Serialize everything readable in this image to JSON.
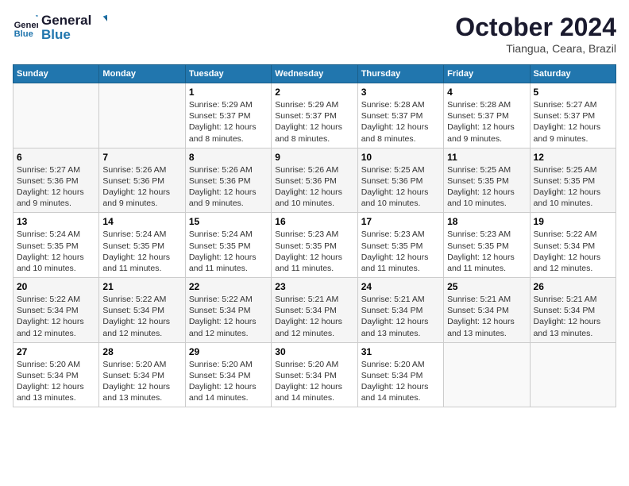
{
  "logo": {
    "line1": "General",
    "line2": "Blue"
  },
  "title": "October 2024",
  "location": "Tiangua, Ceara, Brazil",
  "days_of_week": [
    "Sunday",
    "Monday",
    "Tuesday",
    "Wednesday",
    "Thursday",
    "Friday",
    "Saturday"
  ],
  "weeks": [
    [
      {
        "day": "",
        "info": ""
      },
      {
        "day": "",
        "info": ""
      },
      {
        "day": "1",
        "info": "Sunrise: 5:29 AM\nSunset: 5:37 PM\nDaylight: 12 hours and 8 minutes."
      },
      {
        "day": "2",
        "info": "Sunrise: 5:29 AM\nSunset: 5:37 PM\nDaylight: 12 hours and 8 minutes."
      },
      {
        "day": "3",
        "info": "Sunrise: 5:28 AM\nSunset: 5:37 PM\nDaylight: 12 hours and 8 minutes."
      },
      {
        "day": "4",
        "info": "Sunrise: 5:28 AM\nSunset: 5:37 PM\nDaylight: 12 hours and 9 minutes."
      },
      {
        "day": "5",
        "info": "Sunrise: 5:27 AM\nSunset: 5:37 PM\nDaylight: 12 hours and 9 minutes."
      }
    ],
    [
      {
        "day": "6",
        "info": "Sunrise: 5:27 AM\nSunset: 5:36 PM\nDaylight: 12 hours and 9 minutes."
      },
      {
        "day": "7",
        "info": "Sunrise: 5:26 AM\nSunset: 5:36 PM\nDaylight: 12 hours and 9 minutes."
      },
      {
        "day": "8",
        "info": "Sunrise: 5:26 AM\nSunset: 5:36 PM\nDaylight: 12 hours and 9 minutes."
      },
      {
        "day": "9",
        "info": "Sunrise: 5:26 AM\nSunset: 5:36 PM\nDaylight: 12 hours and 10 minutes."
      },
      {
        "day": "10",
        "info": "Sunrise: 5:25 AM\nSunset: 5:36 PM\nDaylight: 12 hours and 10 minutes."
      },
      {
        "day": "11",
        "info": "Sunrise: 5:25 AM\nSunset: 5:35 PM\nDaylight: 12 hours and 10 minutes."
      },
      {
        "day": "12",
        "info": "Sunrise: 5:25 AM\nSunset: 5:35 PM\nDaylight: 12 hours and 10 minutes."
      }
    ],
    [
      {
        "day": "13",
        "info": "Sunrise: 5:24 AM\nSunset: 5:35 PM\nDaylight: 12 hours and 10 minutes."
      },
      {
        "day": "14",
        "info": "Sunrise: 5:24 AM\nSunset: 5:35 PM\nDaylight: 12 hours and 11 minutes."
      },
      {
        "day": "15",
        "info": "Sunrise: 5:24 AM\nSunset: 5:35 PM\nDaylight: 12 hours and 11 minutes."
      },
      {
        "day": "16",
        "info": "Sunrise: 5:23 AM\nSunset: 5:35 PM\nDaylight: 12 hours and 11 minutes."
      },
      {
        "day": "17",
        "info": "Sunrise: 5:23 AM\nSunset: 5:35 PM\nDaylight: 12 hours and 11 minutes."
      },
      {
        "day": "18",
        "info": "Sunrise: 5:23 AM\nSunset: 5:35 PM\nDaylight: 12 hours and 11 minutes."
      },
      {
        "day": "19",
        "info": "Sunrise: 5:22 AM\nSunset: 5:34 PM\nDaylight: 12 hours and 12 minutes."
      }
    ],
    [
      {
        "day": "20",
        "info": "Sunrise: 5:22 AM\nSunset: 5:34 PM\nDaylight: 12 hours and 12 minutes."
      },
      {
        "day": "21",
        "info": "Sunrise: 5:22 AM\nSunset: 5:34 PM\nDaylight: 12 hours and 12 minutes."
      },
      {
        "day": "22",
        "info": "Sunrise: 5:22 AM\nSunset: 5:34 PM\nDaylight: 12 hours and 12 minutes."
      },
      {
        "day": "23",
        "info": "Sunrise: 5:21 AM\nSunset: 5:34 PM\nDaylight: 12 hours and 12 minutes."
      },
      {
        "day": "24",
        "info": "Sunrise: 5:21 AM\nSunset: 5:34 PM\nDaylight: 12 hours and 13 minutes."
      },
      {
        "day": "25",
        "info": "Sunrise: 5:21 AM\nSunset: 5:34 PM\nDaylight: 12 hours and 13 minutes."
      },
      {
        "day": "26",
        "info": "Sunrise: 5:21 AM\nSunset: 5:34 PM\nDaylight: 12 hours and 13 minutes."
      }
    ],
    [
      {
        "day": "27",
        "info": "Sunrise: 5:20 AM\nSunset: 5:34 PM\nDaylight: 12 hours and 13 minutes."
      },
      {
        "day": "28",
        "info": "Sunrise: 5:20 AM\nSunset: 5:34 PM\nDaylight: 12 hours and 13 minutes."
      },
      {
        "day": "29",
        "info": "Sunrise: 5:20 AM\nSunset: 5:34 PM\nDaylight: 12 hours and 14 minutes."
      },
      {
        "day": "30",
        "info": "Sunrise: 5:20 AM\nSunset: 5:34 PM\nDaylight: 12 hours and 14 minutes."
      },
      {
        "day": "31",
        "info": "Sunrise: 5:20 AM\nSunset: 5:34 PM\nDaylight: 12 hours and 14 minutes."
      },
      {
        "day": "",
        "info": ""
      },
      {
        "day": "",
        "info": ""
      }
    ]
  ]
}
